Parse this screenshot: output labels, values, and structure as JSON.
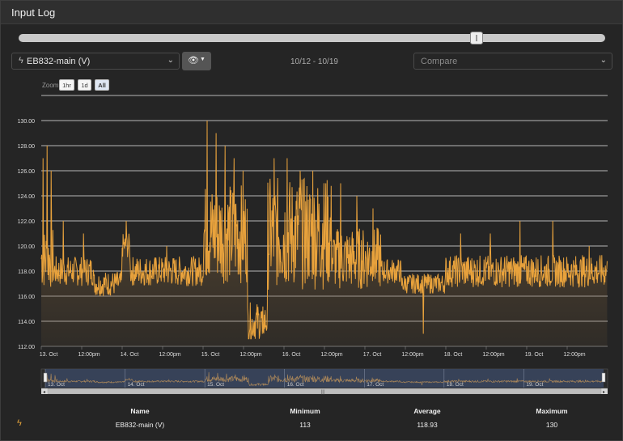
{
  "header": {
    "title": "Input Log"
  },
  "time_slider": {
    "value_fraction": 0.78
  },
  "channel_select": {
    "value": "EB832-main (V)",
    "icon": "bolt-icon"
  },
  "visibility_button": {
    "icon": "eye-icon"
  },
  "date_range": "10/12 - 10/19",
  "compare_select": {
    "placeholder": "Compare"
  },
  "zoom": {
    "label": "Zoom",
    "buttons": [
      "1hr",
      "1d",
      "All"
    ],
    "active": "All"
  },
  "colors": {
    "line": "#e8a23c",
    "fill": "#6b5436",
    "grid": "#ffffff",
    "navigator_bg": "#3a4660",
    "icon": "#e3a23a"
  },
  "chart_data": {
    "type": "area",
    "series": [
      {
        "name": "EB832-main (V)"
      }
    ],
    "ylim": [
      112,
      132
    ],
    "y_ticks": [
      "130.00",
      "128.00",
      "126.00",
      "124.00",
      "122.00",
      "120.00",
      "118.00",
      "116.00",
      "114.00",
      "112.00"
    ],
    "x_ticks": [
      "13. Oct",
      "12:00pm",
      "14. Oct",
      "12:00pm",
      "15. Oct",
      "12:00pm",
      "16. Oct",
      "12:00pm",
      "17. Oct",
      "12:00pm",
      "18. Oct",
      "12:00pm",
      "19. Oct",
      "12:00pm"
    ],
    "navigator_ticks": [
      "13. Oct",
      "14. Oct",
      "15. Oct",
      "16. Oct",
      "17. Oct",
      "18. Oct",
      "19. Oct"
    ],
    "x_range": [
      "2023-10-13 00:00",
      "2023-10-20 00:00"
    ],
    "segments": [
      {
        "t0": 0.0,
        "t1": 0.15,
        "base": 119,
        "noise": 2.5,
        "spikes": [
          127,
          128,
          126
        ]
      },
      {
        "t0": 0.15,
        "t1": 0.65,
        "base": 118,
        "noise": 1.2,
        "spikes": [
          122,
          121
        ]
      },
      {
        "t0": 0.65,
        "t1": 1.0,
        "base": 117,
        "noise": 1.0,
        "spikes": []
      },
      {
        "t0": 1.0,
        "t1": 1.1,
        "base": 120,
        "noise": 1.0,
        "spikes": [
          122
        ]
      },
      {
        "t0": 1.1,
        "t1": 2.0,
        "base": 118,
        "noise": 1.2,
        "spikes": [
          120
        ]
      },
      {
        "t0": 2.0,
        "t1": 2.55,
        "base": 121,
        "noise": 4.0,
        "spikes": [
          130,
          129,
          128,
          127,
          126
        ]
      },
      {
        "t0": 2.55,
        "t1": 2.8,
        "base": 114,
        "noise": 1.5,
        "spikes": [
          113,
          113
        ]
      },
      {
        "t0": 2.8,
        "t1": 3.6,
        "base": 121,
        "noise": 4.5,
        "spikes": [
          127,
          127,
          126,
          126,
          125
        ]
      },
      {
        "t0": 3.6,
        "t1": 4.2,
        "base": 119,
        "noise": 2.5,
        "spikes": [
          125,
          124,
          123
        ]
      },
      {
        "t0": 4.2,
        "t1": 4.45,
        "base": 118,
        "noise": 1.0,
        "spikes": []
      },
      {
        "t0": 4.45,
        "t1": 5.0,
        "base": 117,
        "noise": 0.8,
        "spikes": [
          113
        ]
      },
      {
        "t0": 5.0,
        "t1": 6.1,
        "base": 118,
        "noise": 1.3,
        "spikes": [
          121,
          121,
          122
        ]
      },
      {
        "t0": 6.1,
        "t1": 7.0,
        "base": 118,
        "noise": 1.3,
        "spikes": [
          122,
          120
        ]
      }
    ]
  },
  "stats": {
    "headers": {
      "name": "Name",
      "minimum": "Minimum",
      "average": "Average",
      "maximum": "Maximum"
    },
    "rows": [
      {
        "icon": "bolt-icon",
        "name": "EB832-main (V)",
        "minimum": "113",
        "average": "118.93",
        "maximum": "130"
      }
    ]
  }
}
